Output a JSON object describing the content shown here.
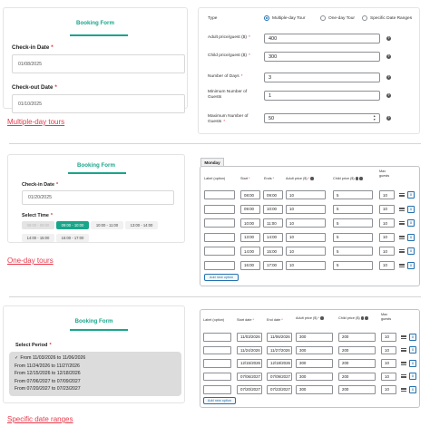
{
  "section1": {
    "form_title": "Booking Form",
    "checkin_label": "Check-in Date",
    "checkin_value": "01/08/2025",
    "checkout_label": "Check-out Date",
    "checkout_value": "01/10/2025",
    "caption": "Multiple-day tours",
    "settings": {
      "type_label": "Type",
      "type_options": [
        "Multiple-day Tour",
        "One-day Tour",
        "Specific Date Ranges"
      ],
      "adult_label": "Adult price/guest ($)",
      "adult_value": "400",
      "child_label": "Child price/guest ($)",
      "child_value": "300",
      "days_label": "Number of Days",
      "days_value": "3",
      "min_label": "Minimum Number of Guests",
      "min_value": "1",
      "max_label": "Maximum Number of Guests",
      "max_value": "50"
    }
  },
  "section2": {
    "form_title": "Booking Form",
    "checkin_label": "Check-in Date",
    "checkin_value": "01/20/2025",
    "select_time_label": "Select Time",
    "time_slots": [
      "08:00 - 09:00",
      "09:00 - 10:00",
      "10:00 - 11:00",
      "13:00 - 14:00",
      "14:00 - 15:00",
      "16:00 - 17:00"
    ],
    "caption": "One-day tours",
    "tab_label": "Monday",
    "headers": {
      "label": "Label (option)",
      "start": "Start",
      "end": "Ends",
      "adult": "Adult price ($)",
      "child": "Child price ($)",
      "max": "Max guests"
    },
    "rows": [
      {
        "start": "08:00",
        "end": "09:00",
        "adult": "10",
        "child": "5",
        "max": "10"
      },
      {
        "start": "09:00",
        "end": "10:00",
        "adult": "10",
        "child": "5",
        "max": "10"
      },
      {
        "start": "10:00",
        "end": "11:00",
        "adult": "10",
        "child": "5",
        "max": "10"
      },
      {
        "start": "13:00",
        "end": "14:00",
        "adult": "10",
        "child": "5",
        "max": "10"
      },
      {
        "start": "14:00",
        "end": "15:00",
        "adult": "10",
        "child": "5",
        "max": "10"
      },
      {
        "start": "16:00",
        "end": "17:00",
        "adult": "10",
        "child": "5",
        "max": "10"
      }
    ],
    "add_button": "Add new option",
    "remove_glyph": "x"
  },
  "section3": {
    "form_title": "Booking Form",
    "select_period_label": "Select Period",
    "periods": [
      "From 11/03/2026 to 11/06/2026",
      "From 11/24/2026 to 11/27/2026",
      "From 12/15/2026 to 12/18/2026",
      "From 07/06/2027 to 07/09/2027",
      "From 07/20/2027 to 07/23/2027"
    ],
    "caption": "Specific date ranges",
    "headers": {
      "label": "Label (option)",
      "start": "Start date",
      "end": "End date",
      "adult": "Adult price ($)",
      "child": "Child price ($)",
      "max": "Max guests"
    },
    "rows": [
      {
        "start": "11/03/2026",
        "end": "11/06/2026",
        "adult": "300",
        "child": "200",
        "max": "10"
      },
      {
        "start": "11/24/2026",
        "end": "11/27/2026",
        "adult": "300",
        "child": "200",
        "max": "10"
      },
      {
        "start": "12/15/2026",
        "end": "12/18/2026",
        "adult": "300",
        "child": "200",
        "max": "10"
      },
      {
        "start": "07/06/2027",
        "end": "07/09/2027",
        "adult": "300",
        "child": "200",
        "max": "10"
      },
      {
        "start": "07/20/2027",
        "end": "07/23/2027",
        "adult": "300",
        "child": "200",
        "max": "10"
      }
    ],
    "add_button": "Add new option",
    "remove_glyph": "x"
  },
  "colors": {
    "accent": "#1aa58a",
    "caption": "#e8394a",
    "required": "#d9363e",
    "wp_blue": "#2271b1"
  }
}
